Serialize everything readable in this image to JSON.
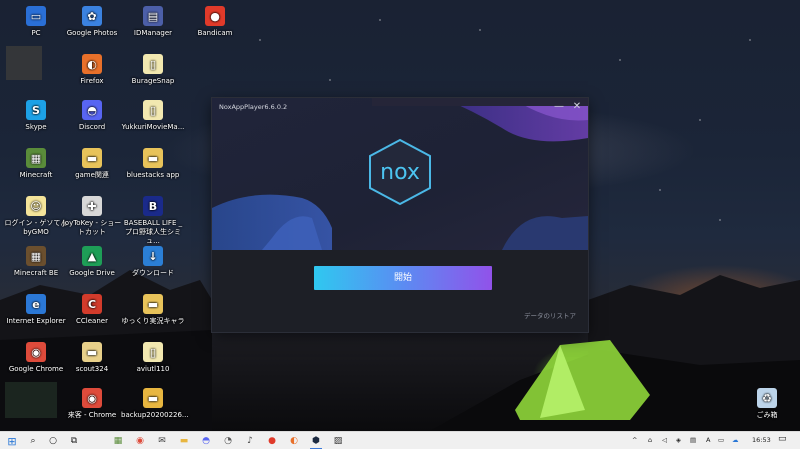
{
  "desktop": {
    "icons": [
      {
        "label": "PC",
        "name": "pc-icon",
        "bg": "#2a6fd6",
        "sym": "▭"
      },
      {
        "label": "Skype",
        "name": "skype-icon",
        "bg": "#1da1e6",
        "sym": "S"
      },
      {
        "label": "Minecraft",
        "name": "minecraft-icon",
        "bg": "#5a8c3a",
        "sym": "▦"
      },
      {
        "label": "ログイン - ゲソてん byGMO",
        "name": "gesoten-login-icon",
        "bg": "#f4e49a",
        "sym": "☺"
      },
      {
        "label": "Minecraft BE",
        "name": "minecraft-be-icon",
        "bg": "#6b4f2e",
        "sym": "▦"
      },
      {
        "label": "Internet Explorer",
        "name": "internet-explorer-icon",
        "bg": "#2b78d6",
        "sym": "e"
      },
      {
        "label": "Google Chrome",
        "name": "google-chrome-icon",
        "bg": "#de4b3b",
        "sym": "◉"
      },
      {
        "label": "Google Photos",
        "name": "google-photos-icon",
        "bg": "#3b82e0",
        "sym": "✿"
      },
      {
        "label": "Firefox",
        "name": "firefox-icon",
        "bg": "#e8702a",
        "sym": "◐"
      },
      {
        "label": "Discord",
        "name": "discord-icon",
        "bg": "#5865f2",
        "sym": "◓"
      },
      {
        "label": "game関連",
        "name": "folder-game-icon",
        "bg": "#e8c35a",
        "sym": "▬"
      },
      {
        "label": "JoyToKey - ショートカット",
        "name": "joytokey-icon",
        "bg": "#d8d8d8",
        "sym": "✚"
      },
      {
        "label": "Google Drive",
        "name": "google-drive-icon",
        "bg": "#1e9e57",
        "sym": "▲"
      },
      {
        "label": "CCleaner",
        "name": "ccleaner-icon",
        "bg": "#d23b2b",
        "sym": "C"
      },
      {
        "label": "scout324",
        "name": "scout324-icon",
        "bg": "#e8d08a",
        "sym": "▬"
      },
      {
        "label": "来客 - Chrome",
        "name": "raikyaku-chrome-icon",
        "bg": "#de4b3b",
        "sym": "◉"
      },
      {
        "label": "IDManager",
        "name": "idmanager-icon",
        "bg": "#4c5fa8",
        "sym": "▤"
      },
      {
        "label": "BurageSnap",
        "name": "buragesnap-icon",
        "bg": "#f2e8b0",
        "sym": "▯"
      },
      {
        "label": "YukkuriMovieMa...",
        "name": "yukkurimoviemaker-icon",
        "bg": "#f2e8b0",
        "sym": "▯"
      },
      {
        "label": "bluestacks app",
        "name": "bluestacks-folder-icon",
        "bg": "#e8c35a",
        "sym": "▬"
      },
      {
        "label": "BASEBALL LIFE _ プロ野球人生シミュ...",
        "name": "baseball-life-icon",
        "bg": "#1a2a8a",
        "sym": "B"
      },
      {
        "label": "ダウンロード",
        "name": "download-icon",
        "bg": "#2b7fd6",
        "sym": "↓"
      },
      {
        "label": "ゆっくり実況キャラ",
        "name": "yukkuri-chara-folder-icon",
        "bg": "#e8c35a",
        "sym": "▬"
      },
      {
        "label": "aviutl110",
        "name": "aviutl110-icon",
        "bg": "#f2e8b0",
        "sym": "▯"
      },
      {
        "label": "backup20200226...",
        "name": "backup-folder-icon",
        "bg": "#e8b640",
        "sym": "▬"
      },
      {
        "label": "Bandicam",
        "name": "bandicam-icon",
        "bg": "#e03a2a",
        "sym": "●"
      },
      {
        "label": "ごみ箱",
        "name": "recycle-bin-icon",
        "bg": "#bcd4ea",
        "sym": "♻"
      }
    ]
  },
  "nox": {
    "title": "NoxAppPlayer6.6.0.2",
    "logo_text": "nox",
    "minimize": "—",
    "close": "✕",
    "start_label": "開始",
    "restore_label": "データのリストア"
  },
  "taskbar": {
    "start": "⊞",
    "search": "⌕",
    "cortana": "○",
    "taskview": "⧉",
    "clock": "16:53",
    "notification": "▭",
    "tray_chevron": "^",
    "items": [
      {
        "name": "taskbar-minecraft-icon",
        "sym": "▦",
        "color": "#5a8c3a"
      },
      {
        "name": "taskbar-chrome-icon",
        "sym": "◉",
        "color": "#de4b3b"
      },
      {
        "name": "taskbar-mail-icon",
        "sym": "✉",
        "color": "#444"
      },
      {
        "name": "taskbar-folder-icon",
        "sym": "▬",
        "color": "#e8b640"
      },
      {
        "name": "taskbar-discord-icon",
        "sym": "◓",
        "color": "#5865f2"
      },
      {
        "name": "taskbar-alarm-icon",
        "sym": "◔",
        "color": "#555"
      },
      {
        "name": "taskbar-music-icon",
        "sym": "♪",
        "color": "#444"
      },
      {
        "name": "taskbar-bandicam-icon",
        "sym": "●",
        "color": "#e03a2a"
      },
      {
        "name": "taskbar-firefox-icon",
        "sym": "◐",
        "color": "#e8702a"
      },
      {
        "name": "taskbar-nox-icon",
        "sym": "⬢",
        "color": "#1c2a40"
      },
      {
        "name": "taskbar-photos-icon",
        "sym": "▨",
        "color": "#333"
      }
    ]
  }
}
